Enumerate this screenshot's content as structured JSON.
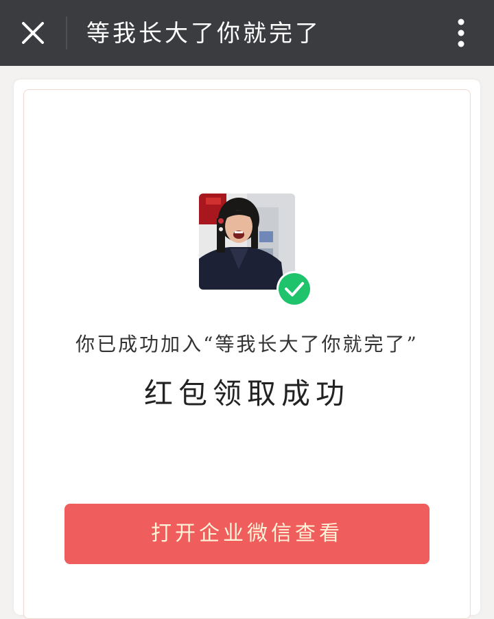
{
  "header": {
    "title": "等我长大了你就完了",
    "close_icon": "close-icon",
    "more_icon": "more-vertical-icon"
  },
  "card": {
    "joined_text": "你已成功加入“等我长大了你就完了”",
    "success_text": "红包领取成功",
    "button_label": "打开企业微信查看",
    "check_icon": "check-circle-icon"
  },
  "colors": {
    "header_bg": "#3b3c40",
    "button_bg": "#ef5e5d",
    "button_text": "#fff3d9",
    "check_green": "#1fc36b"
  }
}
